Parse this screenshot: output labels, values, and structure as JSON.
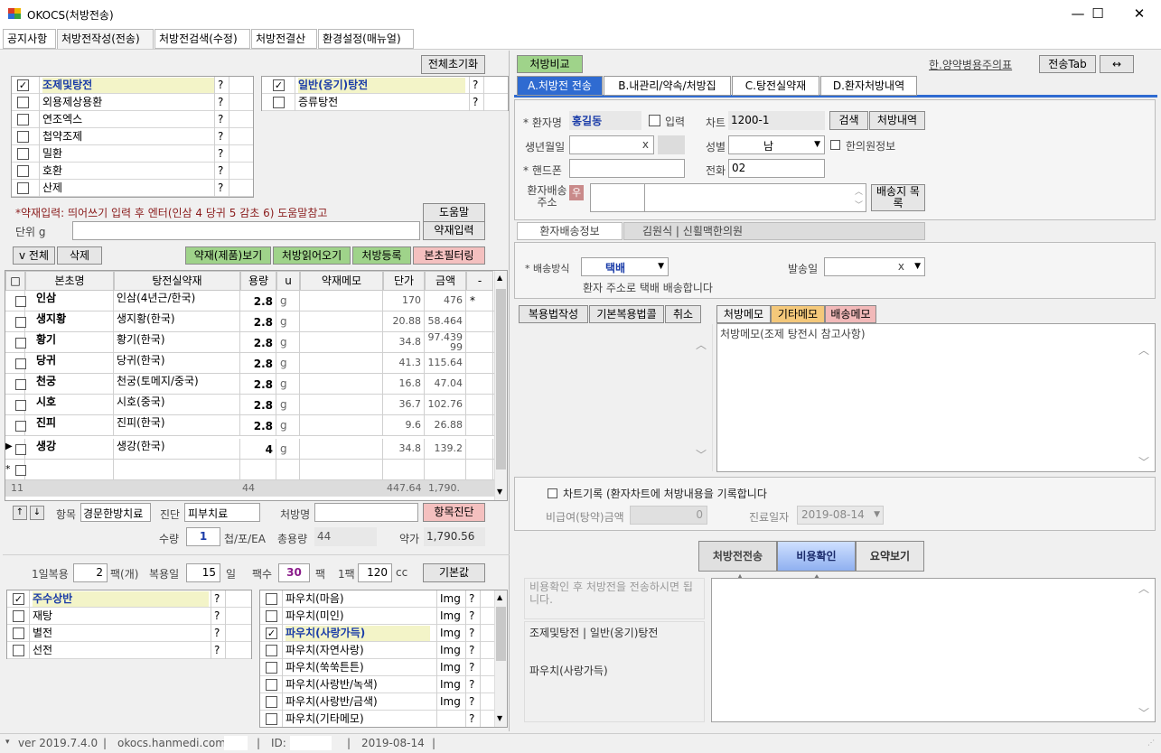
{
  "window": {
    "title": "OKOCS(처방전송)",
    "min": "—",
    "max": "☐",
    "close": "✕"
  },
  "menu": [
    "공지사항",
    "처방전작성(전송)",
    "처방전검색(수정)",
    "처방전결산",
    "환경설정(매뉴얼)"
  ],
  "left": {
    "reset_all": "전체초기화",
    "types_left": [
      {
        "name": "조제및탕전",
        "checked": true,
        "q": "?"
      },
      {
        "name": "외용제상용환",
        "checked": false,
        "q": "?"
      },
      {
        "name": "연조엑스",
        "checked": false,
        "q": "?"
      },
      {
        "name": "첩약조제",
        "checked": false,
        "q": "?"
      },
      {
        "name": "밀환",
        "checked": false,
        "q": "?"
      },
      {
        "name": "호환",
        "checked": false,
        "q": "?"
      },
      {
        "name": "산제",
        "checked": false,
        "q": "?"
      }
    ],
    "types_right": [
      {
        "name": "일반(옹기)탕전",
        "checked": true,
        "q": "?"
      },
      {
        "name": "증류탕전",
        "checked": false,
        "q": "?"
      }
    ],
    "herb_hint": "*약재입력: 띄어쓰기 입력 후 엔터(인삼 4 당귀 5 감초 6) 도움말참고",
    "help_btn": "도움말",
    "unit_label": "단위 g",
    "herb_input_btn": "약재입력",
    "all_btn": "v 전체",
    "delete_btn": "삭제",
    "herb_view_btn": "약재(제품)보기",
    "rx_load_btn": "처방읽어오기",
    "rx_register_btn": "처방등록",
    "filter_btn": "본초필터링",
    "columns": [
      "□",
      "본초명",
      "탕전실약재",
      "용량",
      "u",
      "약재메모",
      "단가",
      "금액",
      "-"
    ],
    "rows": [
      {
        "name": "인삼",
        "herb": "인삼(4년근/한국)",
        "amount": "2.8",
        "u": "g",
        "price": "170",
        "total": "476",
        "mark": "*"
      },
      {
        "name": "생지황",
        "herb": "생지황(한국)",
        "amount": "2.8",
        "u": "g",
        "price": "20.88",
        "total": "58.464",
        "mark": ""
      },
      {
        "name": "황기",
        "herb": "황기(한국)",
        "amount": "2.8",
        "u": "g",
        "price": "34.8",
        "total": "97.439 99",
        "mark": ""
      },
      {
        "name": "당귀",
        "herb": "당귀(한국)",
        "amount": "2.8",
        "u": "g",
        "price": "41.3",
        "total": "115.64",
        "mark": ""
      },
      {
        "name": "천궁",
        "herb": "천궁(토메지/중국)",
        "amount": "2.8",
        "u": "g",
        "price": "16.8",
        "total": "47.04",
        "mark": ""
      },
      {
        "name": "시호",
        "herb": "시호(중국)",
        "amount": "2.8",
        "u": "g",
        "price": "36.7",
        "total": "102.76",
        "mark": ""
      },
      {
        "name": "진피",
        "herb": "진피(한국)",
        "amount": "2.8",
        "u": "g",
        "price": "9.6",
        "total": "26.88",
        "mark": ""
      },
      {
        "name": "생강",
        "herb": "생강(한국)",
        "amount": "4",
        "u": "g",
        "price": "34.8",
        "total": "139.2",
        "mark": ""
      }
    ],
    "footer": {
      "count": "11",
      "amount": "44",
      "price": "447.64",
      "total": "1,790."
    },
    "item_label": "항목",
    "item_value": "경문한방치료",
    "diag_label": "진단",
    "diag_value": "피부치료",
    "rxname_label": "처방명",
    "rxname_value": "",
    "item_diag_btn": "항목진단",
    "qty_label": "수량",
    "qty_value": "1",
    "qty_unit": "첩/포/EA",
    "total_qty_label": "총용량",
    "total_qty_value": "44",
    "price_label": "약가",
    "price_value": "1,790.56",
    "daily_label": "1일복용",
    "daily_value": "2",
    "daily_unit": "팩(개)",
    "days_label": "복용일",
    "days_value": "15",
    "days_unit": "일",
    "packs_label": "팩수",
    "packs_value": "30",
    "packs_unit": "팩",
    "per_pack_label": "1팩",
    "per_pack_value": "120",
    "per_pack_unit": "cc",
    "default_btn": "기본값",
    "extras_left": [
      {
        "name": "주수상반",
        "checked": true,
        "q": "?"
      },
      {
        "name": "재탕",
        "checked": false,
        "q": "?"
      },
      {
        "name": "별전",
        "checked": false,
        "q": "?"
      },
      {
        "name": "선전",
        "checked": false,
        "q": "?"
      }
    ],
    "pouches": [
      {
        "name": "파우치(마음)",
        "checked": false,
        "img": "Img",
        "q": "?"
      },
      {
        "name": "파우치(미인)",
        "checked": false,
        "img": "Img",
        "q": "?"
      },
      {
        "name": "파우치(사랑가득)",
        "checked": true,
        "img": "Img",
        "q": "?"
      },
      {
        "name": "파우치(자연사랑)",
        "checked": false,
        "img": "Img",
        "q": "?"
      },
      {
        "name": "파우치(쑥쑥튼튼)",
        "checked": false,
        "img": "Img",
        "q": "?"
      },
      {
        "name": "파우치(사랑반/녹색)",
        "checked": false,
        "img": "Img",
        "q": "?"
      },
      {
        "name": "파우치(사랑반/금색)",
        "checked": false,
        "img": "Img",
        "q": "?"
      },
      {
        "name": "파우치(기타메모)",
        "checked": false,
        "img": "",
        "q": "?"
      }
    ]
  },
  "right": {
    "compare_btn": "처방비교",
    "caution_link": "한.양약병용주의표",
    "send_tab_btn": "전송Tab",
    "swap_btn": "↔",
    "tabs": [
      "A.처방전 전송",
      "B.내관리/약속/처방집",
      "C.탕전실약재",
      "D.환자처방내역"
    ],
    "patient_label": "* 환자명",
    "patient_value": "홍길동",
    "input_label": "입력",
    "chart_label": "차트",
    "chart_value": "1200-1",
    "search_btn": "검색",
    "history_btn": "처방내역",
    "birth_label": "생년월일",
    "birth_x": "x",
    "sex_label": "성별",
    "sex_value": "남",
    "oriental_label": "한의원정보",
    "phone_label": "* 핸드폰",
    "tel_label": "전화",
    "tel_value": "02",
    "addr_label": "환자배송 주소",
    "addr_badge": "우",
    "addr_btn": "배송지 목록",
    "ship_tabs": [
      "환자배송정보",
      "김원식 | 신횔맥한의원"
    ],
    "method_label": "* 배송방식",
    "method_value": "택배",
    "send_date_label": "발송일",
    "send_date_x": "x",
    "ship_note": "환자 주소로 택배 배송합니다",
    "dose_btns": [
      "복용법작성",
      "기본복용법콜",
      "취소"
    ],
    "memo_tabs": [
      "처방메모",
      "기타메모",
      "배송메모"
    ],
    "memo_text": "처방메모(조제 탕전시 참고사항)",
    "chart_record": "차트기록 (환자차트에 처방내용을 기록합니다",
    "nonpay_label": "비급여(탕약)금액",
    "nonpay_value": "0",
    "date_label": "진료일자",
    "date_value": "2019-08-14",
    "action_btns": [
      "처방전전송",
      "비용확인",
      "요약보기"
    ],
    "info_text": "비용확인 후 처방전을 전송하시면 됩니다.",
    "summary1": "조제및탕전 | 일반(옹기)탕전",
    "summary2": "파우치(사랑가득)"
  },
  "status": {
    "version": "ver 2019.7.4.0",
    "sep": "|",
    "site": "okocs.hanmedi.com",
    "id_label": "ID:",
    "date": "2019-08-14"
  }
}
